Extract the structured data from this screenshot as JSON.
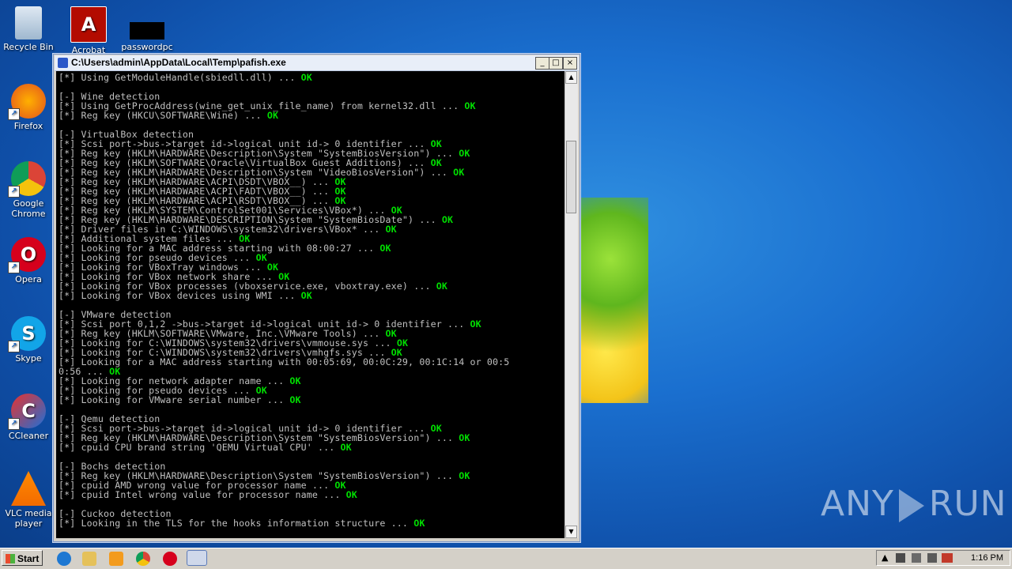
{
  "desktop": {
    "icons": [
      {
        "label": "Recycle Bin",
        "icon": "recycle-bin-icon"
      },
      {
        "label": "Firefox",
        "icon": "firefox-icon"
      },
      {
        "label": "Google Chrome",
        "icon": "chrome-icon"
      },
      {
        "label": "Opera",
        "icon": "opera-icon"
      },
      {
        "label": "Skype",
        "icon": "skype-icon"
      },
      {
        "label": "CCleaner",
        "icon": "ccleaner-icon"
      },
      {
        "label": "VLC media player",
        "icon": "vlc-icon"
      },
      {
        "label": "Acrobat",
        "icon": "acrobat-icon"
      },
      {
        "label": "passwordpc",
        "icon": "file-icon"
      }
    ]
  },
  "window": {
    "title": "C:\\Users\\admin\\AppData\\Local\\Temp\\pafish.exe",
    "minimize": "_",
    "maximize": "□",
    "close": "×"
  },
  "console": {
    "lines": [
      {
        "text": "[*] Using GetModuleHandle(sbiedll.dll) ... ",
        "status": "OK"
      },
      {
        "text": "",
        "status": ""
      },
      {
        "text": "[-] Wine detection",
        "status": ""
      },
      {
        "text": "[*] Using GetProcAddress(wine_get_unix_file_name) from kernel32.dll ... ",
        "status": "OK"
      },
      {
        "text": "[*] Reg key (HKCU\\SOFTWARE\\Wine) ... ",
        "status": "OK"
      },
      {
        "text": "",
        "status": ""
      },
      {
        "text": "[-] VirtualBox detection",
        "status": ""
      },
      {
        "text": "[*] Scsi port->bus->target id->logical unit id-> 0 identifier ... ",
        "status": "OK"
      },
      {
        "text": "[*] Reg key (HKLM\\HARDWARE\\Description\\System \"SystemBiosVersion\") ... ",
        "status": "OK"
      },
      {
        "text": "[*] Reg key (HKLM\\SOFTWARE\\Oracle\\VirtualBox Guest Additions) ... ",
        "status": "OK"
      },
      {
        "text": "[*] Reg key (HKLM\\HARDWARE\\Description\\System \"VideoBiosVersion\") ... ",
        "status": "OK"
      },
      {
        "text": "[*] Reg key (HKLM\\HARDWARE\\ACPI\\DSDT\\VBOX__) ... ",
        "status": "OK"
      },
      {
        "text": "[*] Reg key (HKLM\\HARDWARE\\ACPI\\FADT\\VBOX__) ... ",
        "status": "OK"
      },
      {
        "text": "[*] Reg key (HKLM\\HARDWARE\\ACPI\\RSDT\\VBOX__) ... ",
        "status": "OK"
      },
      {
        "text": "[*] Reg key (HKLM\\SYSTEM\\ControlSet001\\Services\\VBox*) ... ",
        "status": "OK"
      },
      {
        "text": "[*] Reg key (HKLM\\HARDWARE\\DESCRIPTION\\System \"SystemBiosDate\") ... ",
        "status": "OK"
      },
      {
        "text": "[*] Driver files in C:\\WINDOWS\\system32\\drivers\\VBox* ... ",
        "status": "OK"
      },
      {
        "text": "[*] Additional system files ... ",
        "status": "OK"
      },
      {
        "text": "[*] Looking for a MAC address starting with 08:00:27 ... ",
        "status": "OK"
      },
      {
        "text": "[*] Looking for pseudo devices ... ",
        "status": "OK"
      },
      {
        "text": "[*] Looking for VBoxTray windows ... ",
        "status": "OK"
      },
      {
        "text": "[*] Looking for VBox network share ... ",
        "status": "OK"
      },
      {
        "text": "[*] Looking for VBox processes (vboxservice.exe, vboxtray.exe) ... ",
        "status": "OK"
      },
      {
        "text": "[*] Looking for VBox devices using WMI ... ",
        "status": "OK"
      },
      {
        "text": "",
        "status": ""
      },
      {
        "text": "[-] VMware detection",
        "status": ""
      },
      {
        "text": "[*] Scsi port 0,1,2 ->bus->target id->logical unit id-> 0 identifier ... ",
        "status": "OK"
      },
      {
        "text": "[*] Reg key (HKLM\\SOFTWARE\\VMware, Inc.\\VMware Tools) ... ",
        "status": "OK"
      },
      {
        "text": "[*] Looking for C:\\WINDOWS\\system32\\drivers\\vmmouse.sys ... ",
        "status": "OK"
      },
      {
        "text": "[*] Looking for C:\\WINDOWS\\system32\\drivers\\vmhgfs.sys ... ",
        "status": "OK"
      },
      {
        "text": "[*] Looking for a MAC address starting with 00:05:69, 00:0C:29, 00:1C:14 or 00:5",
        "status": ""
      },
      {
        "text": "0:56 ... ",
        "status": "OK"
      },
      {
        "text": "[*] Looking for network adapter name ... ",
        "status": "OK"
      },
      {
        "text": "[*] Looking for pseudo devices ... ",
        "status": "OK"
      },
      {
        "text": "[*] Looking for VMware serial number ... ",
        "status": "OK"
      },
      {
        "text": "",
        "status": ""
      },
      {
        "text": "[-] Qemu detection",
        "status": ""
      },
      {
        "text": "[*] Scsi port->bus->target id->logical unit id-> 0 identifier ... ",
        "status": "OK"
      },
      {
        "text": "[*] Reg key (HKLM\\HARDWARE\\Description\\System \"SystemBiosVersion\") ... ",
        "status": "OK"
      },
      {
        "text": "[*] cpuid CPU brand string 'QEMU Virtual CPU' ... ",
        "status": "OK"
      },
      {
        "text": "",
        "status": ""
      },
      {
        "text": "[-] Bochs detection",
        "status": ""
      },
      {
        "text": "[*] Reg key (HKLM\\HARDWARE\\Description\\System \"SystemBiosVersion\") ... ",
        "status": "OK"
      },
      {
        "text": "[*] cpuid AMD wrong value for processor name ... ",
        "status": "OK"
      },
      {
        "text": "[*] cpuid Intel wrong value for processor name ... ",
        "status": "OK"
      },
      {
        "text": "",
        "status": ""
      },
      {
        "text": "[-] Cuckoo detection",
        "status": ""
      },
      {
        "text": "[*] Looking in the TLS for the hooks information structure ... ",
        "status": "OK"
      }
    ]
  },
  "watermark": {
    "left": "ANY",
    "right": "RUN"
  },
  "taskbar": {
    "start_label": "Start",
    "clock": "1:16 PM"
  },
  "colors": {
    "ok": "#00e000",
    "console_text": "#c0c0c0",
    "console_bg": "#000000"
  }
}
